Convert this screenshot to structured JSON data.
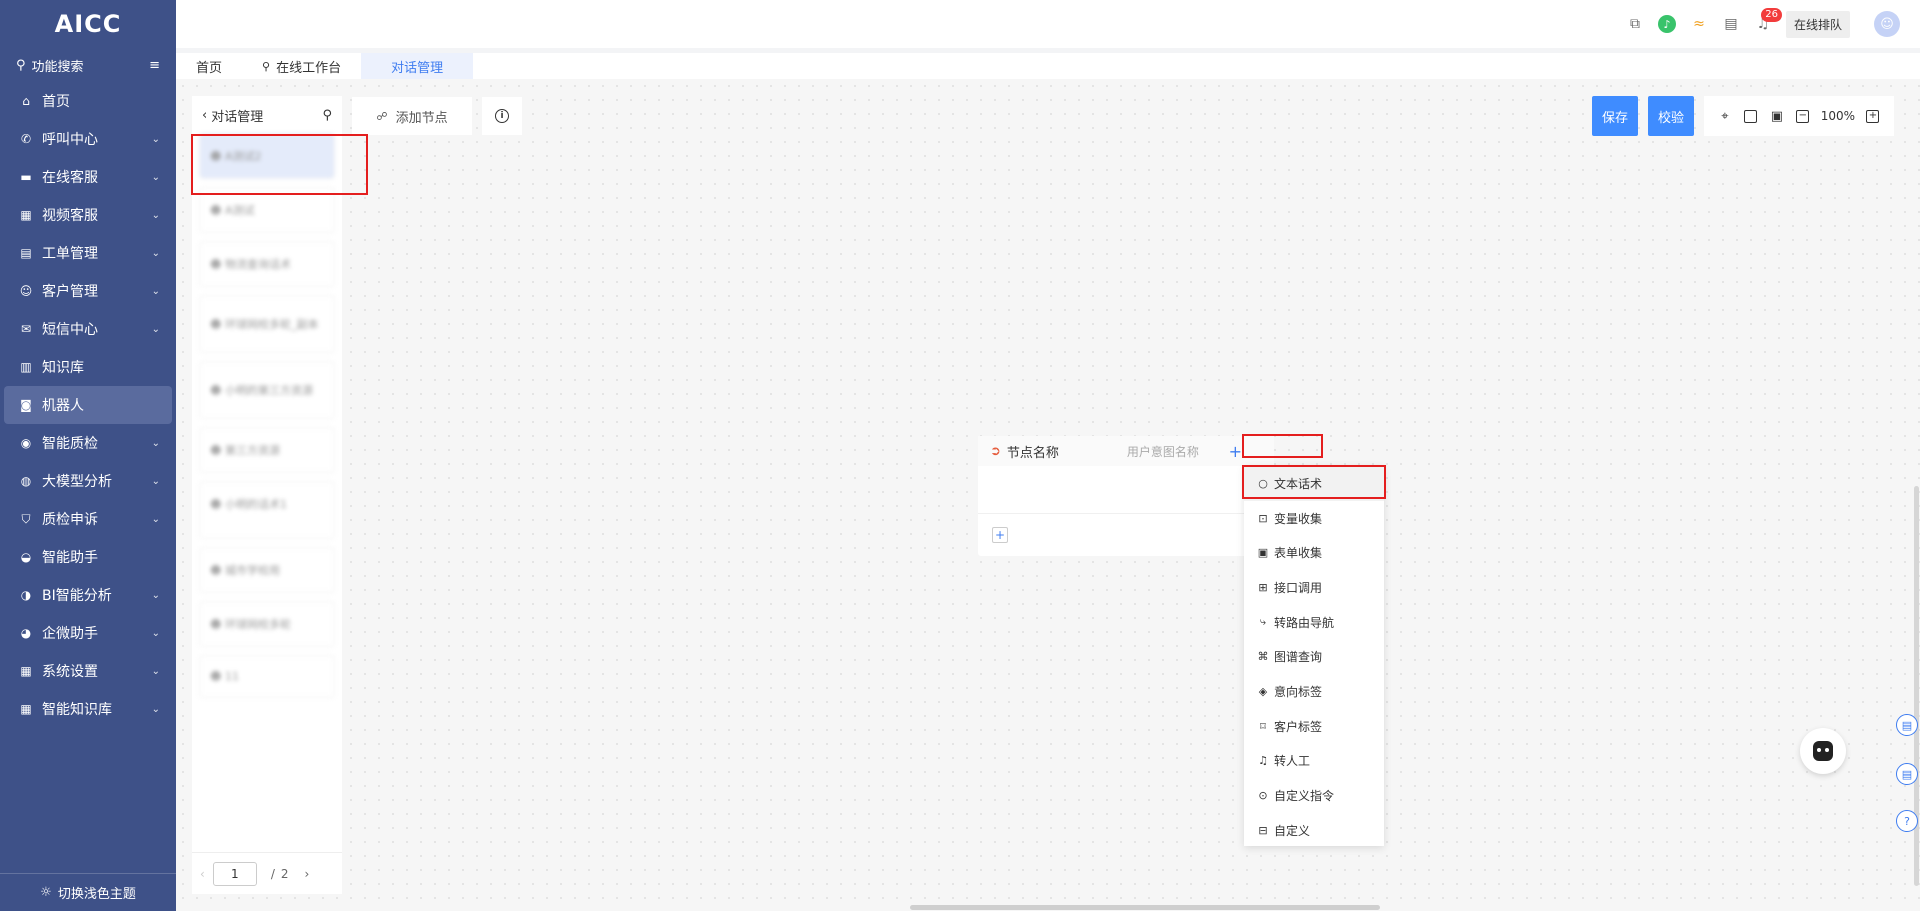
{
  "app": {
    "logo": "AICC"
  },
  "sidebar": {
    "search_label": "功能搜索",
    "items": [
      {
        "label": "首页",
        "icon": "home-icon",
        "glyph": "⌂",
        "has_children": false
      },
      {
        "label": "呼叫中心",
        "icon": "phone-icon",
        "glyph": "✆",
        "has_children": true
      },
      {
        "label": "在线客服",
        "icon": "chat-icon",
        "glyph": "▬",
        "has_children": true
      },
      {
        "label": "视频客服",
        "icon": "grid-icon",
        "glyph": "▦",
        "has_children": true
      },
      {
        "label": "工单管理",
        "icon": "clipboard-icon",
        "glyph": "▤",
        "has_children": true
      },
      {
        "label": "客户管理",
        "icon": "users-icon",
        "glyph": "☺",
        "has_children": true
      },
      {
        "label": "短信中心",
        "icon": "mail-icon",
        "glyph": "✉",
        "has_children": true
      },
      {
        "label": "知识库",
        "icon": "library-icon",
        "glyph": "▥",
        "has_children": false
      },
      {
        "label": "机器人",
        "icon": "robot-icon",
        "glyph": "◙",
        "has_children": false,
        "active": true
      },
      {
        "label": "智能质检",
        "icon": "inspect-icon",
        "glyph": "◉",
        "has_children": true
      },
      {
        "label": "大模型分析",
        "icon": "model-icon",
        "glyph": "◍",
        "has_children": true
      },
      {
        "label": "质检申诉",
        "icon": "shield-icon",
        "glyph": "⛉",
        "has_children": true
      },
      {
        "label": "智能助手",
        "icon": "assistant-icon",
        "glyph": "◒",
        "has_children": false
      },
      {
        "label": "BI智能分析",
        "icon": "pie-chart-icon",
        "glyph": "◑",
        "has_children": true
      },
      {
        "label": "企微助手",
        "icon": "wecom-icon",
        "glyph": "◕",
        "has_children": true
      },
      {
        "label": "系统设置",
        "icon": "settings-grid-icon",
        "glyph": "▦",
        "has_children": true
      },
      {
        "label": "智能知识库",
        "icon": "knowledge-icon",
        "glyph": "▦",
        "has_children": true
      }
    ],
    "theme_switch": "切换浅色主题"
  },
  "topbar": {
    "notification_count": "26",
    "queue_label": "在线排队"
  },
  "tabs": [
    {
      "label": "首页",
      "pinned": false,
      "active": false
    },
    {
      "label": "在线工作台",
      "pinned": true,
      "active": false
    },
    {
      "label": "对话管理",
      "pinned": false,
      "active": true
    }
  ],
  "list_panel": {
    "title": "对话管理",
    "items": [
      {
        "text": "A测试2",
        "sub": ""
      },
      {
        "text": "A测试",
        "sub": ""
      },
      {
        "text": "物流查询话术",
        "sub": ""
      },
      {
        "text": "环球网校多轮_副本",
        "sub": ""
      },
      {
        "text": "小明的第三方资源",
        "sub": ""
      },
      {
        "text": "第三方资源",
        "sub": ""
      },
      {
        "text": "小明的话术1",
        "sub": ""
      },
      {
        "text": "城市学校用",
        "sub": ""
      },
      {
        "text": "环球网校多轮",
        "sub": ""
      },
      {
        "text": "11",
        "sub": ""
      }
    ],
    "pager": {
      "current": "1",
      "total": "2",
      "sep": "/"
    }
  },
  "toolbar": {
    "add_node": "添加节点",
    "save": "保存",
    "check": "校验",
    "zoom": "100%"
  },
  "node": {
    "name": "节点名称",
    "intent_placeholder": "用户意图名称"
  },
  "dropdown": {
    "items": [
      {
        "label": "文本话术",
        "icon": "circle-icon",
        "glyph": "○",
        "active": true
      },
      {
        "label": "变量收集",
        "icon": "variable-icon",
        "glyph": "⊡"
      },
      {
        "label": "表单收集",
        "icon": "form-icon",
        "glyph": "▣"
      },
      {
        "label": "接口调用",
        "icon": "api-icon",
        "glyph": "⊞"
      },
      {
        "label": "转路由导航",
        "icon": "route-icon",
        "glyph": "⤷"
      },
      {
        "label": "图谱查询",
        "icon": "graph-icon",
        "glyph": "⌘"
      },
      {
        "label": "意向标签",
        "icon": "intent-tag-icon",
        "glyph": "◈"
      },
      {
        "label": "客户标签",
        "icon": "tag-icon",
        "glyph": "⌑"
      },
      {
        "label": "转人工",
        "icon": "headset-icon",
        "glyph": "♫"
      },
      {
        "label": "自定义指令",
        "icon": "command-icon",
        "glyph": "⊙"
      },
      {
        "label": "自定义",
        "icon": "custom-icon",
        "glyph": "⊟"
      }
    ]
  }
}
